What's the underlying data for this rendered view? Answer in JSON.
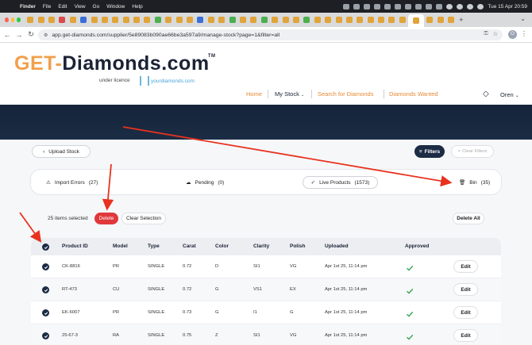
{
  "menubar": {
    "app": "Finder",
    "items": [
      "File",
      "Edit",
      "View",
      "Go",
      "Window",
      "Help"
    ],
    "clock": "Tue 15 Apr 20:59"
  },
  "browser": {
    "url": "app.get-diamonds.com/supplier/5e89083b090ae66be3a597a9/manage-stock?page=1&filter=all",
    "profile_initial": "O"
  },
  "site": {
    "logo_prefix": "GET-",
    "logo_main": "Diamonds.com",
    "logo_tm": "TM",
    "licence": "under licence",
    "partner": "yourdiamonds.com",
    "nav": {
      "home": "Home",
      "my_stock": "My Stock",
      "search": "Search for Diamonds",
      "wanted": "Diamonds Wanted"
    },
    "user": "Oren"
  },
  "toolbar": {
    "upload": "Upload Stock",
    "filters": "Filters",
    "clear_filters": "Clear Filters"
  },
  "status": {
    "errors": "Import Errors",
    "errors_count": "(27)",
    "pending": "Pending",
    "pending_count": "(0)",
    "live": "Live Products",
    "live_count": "(1573)",
    "bin": "Bin",
    "bin_count": "(35)"
  },
  "selection": {
    "count_text": "25 items selected",
    "delete": "Delete",
    "clear": "Clear Selection",
    "delete_all": "Delete All"
  },
  "table": {
    "headers": [
      "Product ID",
      "Model",
      "Type",
      "Carat",
      "Color",
      "Clarity",
      "Polish",
      "Uploaded",
      "Approved"
    ],
    "edit_label": "Edit",
    "rows": [
      {
        "id": "CK-8816",
        "model": "PR",
        "type": "SINGLE",
        "carat": "0.72",
        "color": "D",
        "clarity": "SI1",
        "polish": "VG",
        "uploaded": "Apr 1st 25, 11:14 pm"
      },
      {
        "id": "RT-473",
        "model": "CU",
        "type": "SINGLE",
        "carat": "0.72",
        "color": "G",
        "clarity": "VS1",
        "polish": "EX",
        "uploaded": "Apr 1st 25, 11:14 pm"
      },
      {
        "id": "EK-6007",
        "model": "PR",
        "type": "SINGLE",
        "carat": "0.73",
        "color": "G",
        "clarity": "I1",
        "polish": "G",
        "uploaded": "Apr 1st 25, 11:14 pm"
      },
      {
        "id": "25-67-3",
        "model": "RA",
        "type": "SINGLE",
        "carat": "0.75",
        "color": "Z",
        "clarity": "SI1",
        "polish": "VG",
        "uploaded": "Apr 1st 25, 11:14 pm"
      }
    ]
  },
  "colors": {
    "accent_orange": "#e58a35",
    "navy": "#1b2c44",
    "delete_red": "#e0383b",
    "annotation_red": "#e8321f",
    "approved_green": "#3aa655"
  }
}
